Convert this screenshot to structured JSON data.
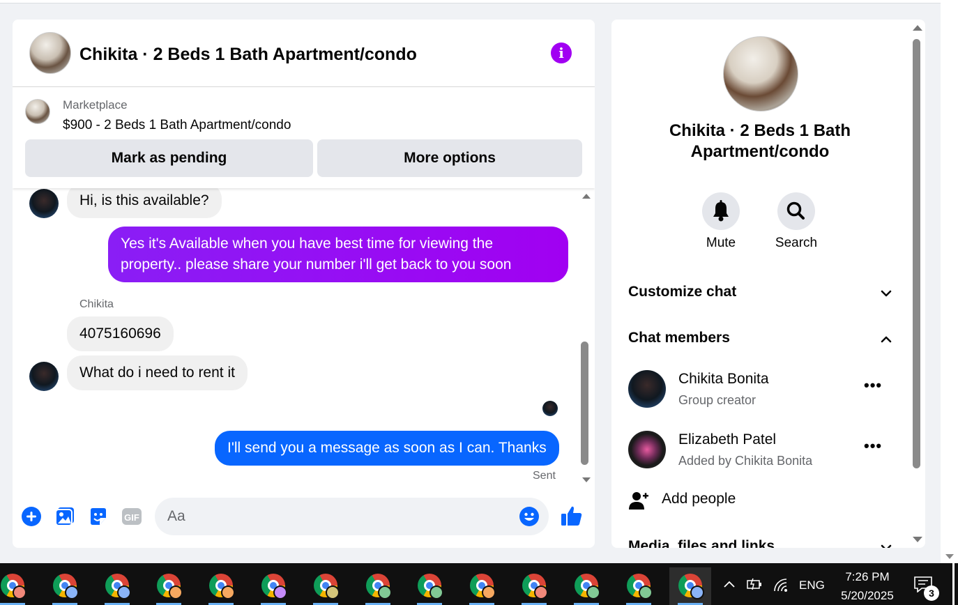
{
  "chat": {
    "title": "Chikita · 2 Beds 1 Bath Apartment/condo",
    "marketplace": {
      "label": "Marketplace",
      "listing": "$900 - 2 Beds 1 Bath Apartment/condo",
      "mark_pending_label": "Mark as pending",
      "more_options_label": "More options"
    },
    "messages": [
      {
        "direction": "in",
        "text": "Hi, is this available?"
      },
      {
        "direction": "out",
        "text": "Yes it's Available when you have best time for viewing the property.. please share your number i'll get back to you soon",
        "lines": [
          "Yes it's Available when you have best time for viewing the",
          "property.. please share your number i'll get back to you soon"
        ]
      },
      {
        "direction": "in",
        "sender": "Chikita",
        "text": "4075160696"
      },
      {
        "direction": "in",
        "text": "What do i need to rent it"
      },
      {
        "direction": "out",
        "text": "I'll send you a message as soon as I can. Thanks"
      }
    ],
    "sent_status": "Sent",
    "composer": {
      "placeholder": "Aa",
      "gif_label": "GIF"
    }
  },
  "info_panel": {
    "title": "Chikita · 2 Beds 1 Bath Apartment/condo",
    "title_lines": [
      "Chikita · 2 Beds 1 Bath",
      "Apartment/condo"
    ],
    "actions": [
      {
        "label": "Mute",
        "icon": "bell-icon"
      },
      {
        "label": "Search",
        "icon": "search-icon"
      }
    ],
    "sections": {
      "customize": "Customize chat",
      "members": "Chat members",
      "media": "Media, files and links"
    },
    "members": [
      {
        "name": "Chikita Bonita",
        "role": "Group creator"
      },
      {
        "name": "Elizabeth Patel",
        "role": "Added by Chikita Bonita"
      }
    ],
    "add_people_label": "Add people"
  },
  "taskbar": {
    "language": "ENG",
    "time": "7:26 PM",
    "date": "5/20/2025",
    "notification_count": "3",
    "apps": [
      "chrome",
      "chrome",
      "chrome",
      "chrome",
      "chrome",
      "chrome",
      "chrome",
      "chrome",
      "chrome",
      "chrome",
      "chrome",
      "chrome",
      "chrome",
      "chrome"
    ],
    "profile_colors": [
      "#f0887a",
      "#8ab4f8",
      "#8ab4f8",
      "#f6a860",
      "#f6a860",
      "#c58af9",
      "#d4c57a",
      "#81c995",
      "#81c995",
      "#f6a860",
      "#f0887a",
      "#81c995",
      "#81c995",
      "#8ab4f8"
    ]
  },
  "colors": {
    "accent_purple": "#a100f2",
    "messenger_blue": "#0866ff",
    "bubble_gradient_start": "#8a1ef5",
    "bubble_gradient_end": "#a100f2"
  }
}
